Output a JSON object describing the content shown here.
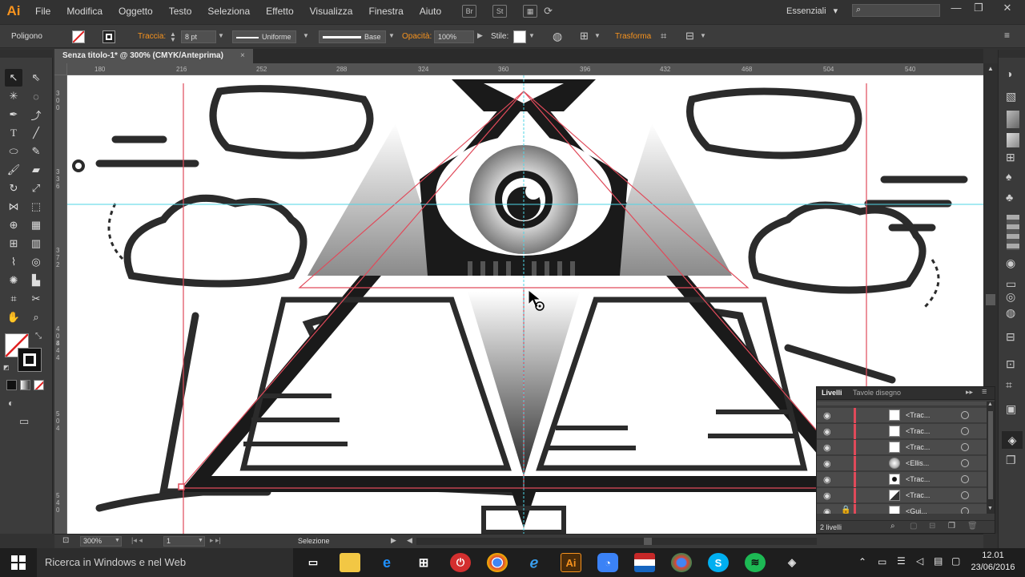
{
  "app": {
    "logo_text": "Ai"
  },
  "menu": {
    "items": [
      "File",
      "Modifica",
      "Oggetto",
      "Testo",
      "Seleziona",
      "Effetto",
      "Visualizza",
      "Finestra",
      "Aiuto"
    ]
  },
  "menubar": {
    "st_label": "St",
    "workspace": "Essenziali",
    "workspace_chevron": "▾"
  },
  "control_bar": {
    "object_type": "Poligono",
    "stroke_label": "Traccia:",
    "stroke_value": "8 pt",
    "profile": "Uniforme",
    "brush": "Base",
    "opacity_label": "Opacità:",
    "opacity_value": "100%",
    "style_label": "Stile:",
    "transform_label": "Trasforma"
  },
  "document": {
    "tab_title": "Senza titolo-1* @ 300% (CMYK/Anteprima)",
    "close_glyph": "×"
  },
  "ruler": {
    "top_ticks": [
      "180",
      "216",
      "252",
      "288",
      "324",
      "360",
      "396",
      "432",
      "468",
      "504",
      "540"
    ],
    "left_ticks": [
      "3 0 0",
      "3 3 6",
      "3 7 2",
      "4 0 8",
      "4 4 4",
      "5 0 4",
      "5 4 0"
    ]
  },
  "status_bar": {
    "zoom": "300%",
    "artboard": "1",
    "tool_status": "Selezione"
  },
  "layers_panel": {
    "tabs": [
      "Livelli",
      "Tavole disegno"
    ],
    "rows": [
      {
        "name": "<Trac..."
      },
      {
        "name": "<Trac..."
      },
      {
        "name": "<Trac..."
      },
      {
        "name": "<Ellis..."
      },
      {
        "name": "<Trac..."
      },
      {
        "name": "<Trac..."
      },
      {
        "name": "<Gui..."
      }
    ],
    "footer_count": "2 livelli"
  },
  "taskbar": {
    "search_placeholder": "Ricerca in Windows e nel Web",
    "ai_label": "Ai",
    "clock_time": "12.01",
    "clock_date": "23/06/2016"
  },
  "colors": {
    "accent": "#f7931e",
    "guide": "#e04a5a",
    "cyan_guide": "#4fd6e6"
  }
}
